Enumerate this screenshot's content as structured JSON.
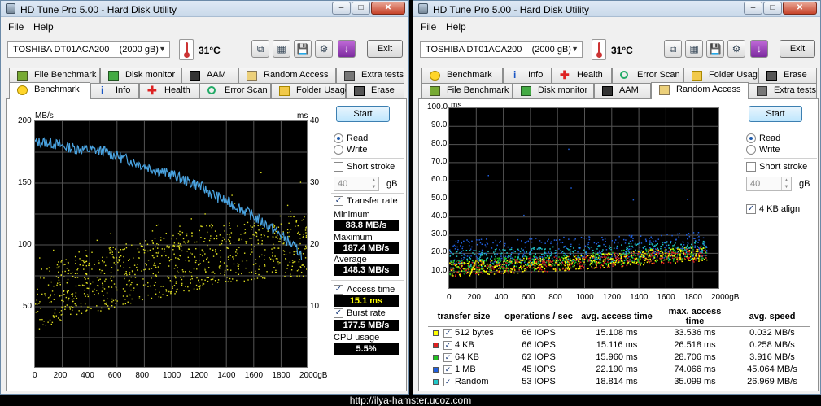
{
  "window_title": "HD Tune Pro 5.00 - Hard Disk Utility",
  "menu": {
    "file": "File",
    "help": "Help"
  },
  "drive": "TOSHIBA DT01ACA200",
  "drive_size": "(2000 gB)",
  "temperature": "31°C",
  "exit_label": "Exit",
  "start_label": "Start",
  "watermark": "http://ilya-hamster.ucoz.com",
  "left": {
    "tabs_row1": [
      "File Benchmark",
      "Disk monitor",
      "AAM",
      "Random Access",
      "Extra tests"
    ],
    "tabs_row2": [
      "Benchmark",
      "Info",
      "Health",
      "Error Scan",
      "Folder Usage",
      "Erase"
    ],
    "active_tab": "Benchmark",
    "chart": {
      "y_left_unit": "MB/s",
      "y_right_unit": "ms",
      "y_left_ticks": [
        "200",
        "150",
        "100",
        "50"
      ],
      "y_right_ticks": [
        "40",
        "30",
        "20",
        "10"
      ],
      "x_ticks": [
        "0",
        "200",
        "400",
        "600",
        "800",
        "1000",
        "1200",
        "1400",
        "1600",
        "1800",
        "2000gB"
      ]
    },
    "read_label": "Read",
    "write_label": "Write",
    "short_stroke_label": "Short stroke",
    "short_stroke_value": "40",
    "gb_label": "gB",
    "transfer_rate_label": "Transfer rate",
    "minimum_label": "Minimum",
    "minimum_value": "88.8 MB/s",
    "maximum_label": "Maximum",
    "maximum_value": "187.4 MB/s",
    "average_label": "Average",
    "average_value": "148.3 MB/s",
    "access_time_label": "Access time",
    "access_time_value": "15.1 ms",
    "burst_rate_label": "Burst rate",
    "burst_rate_value": "177.5 MB/s",
    "cpu_usage_label": "CPU usage",
    "cpu_usage_value": "5.5%"
  },
  "right": {
    "tabs_row1": [
      "Benchmark",
      "Info",
      "Health",
      "Error Scan",
      "Folder Usage",
      "Erase"
    ],
    "tabs_row2": [
      "File Benchmark",
      "Disk monitor",
      "AAM",
      "Random Access",
      "Extra tests"
    ],
    "active_tab": "Random Access",
    "chart": {
      "y_unit": "ms",
      "y_ticks": [
        "100.0",
        "90.0",
        "80.0",
        "70.0",
        "60.0",
        "50.0",
        "40.0",
        "30.0",
        "20.0",
        "10.0"
      ],
      "x_ticks": [
        "0",
        "200",
        "400",
        "600",
        "800",
        "1000",
        "1200",
        "1400",
        "1600",
        "1800",
        "2000gB"
      ]
    },
    "read_label": "Read",
    "write_label": "Write",
    "short_stroke_label": "Short stroke",
    "short_stroke_value": "40",
    "gb_label": "gB",
    "kb_align_label": "4 KB align",
    "table": {
      "headers": [
        "transfer size",
        "operations / sec",
        "avg. access time",
        "max. access time",
        "avg. speed"
      ],
      "rows": [
        {
          "name": "512 bytes",
          "color": "#ffff00",
          "ops": "66 IOPS",
          "avg": "15.108 ms",
          "max": "33.536 ms",
          "speed": "0.032 MB/s"
        },
        {
          "name": "4 KB",
          "color": "#e02020",
          "ops": "66 IOPS",
          "avg": "15.116 ms",
          "max": "26.518 ms",
          "speed": "0.258 MB/s"
        },
        {
          "name": "64 KB",
          "color": "#20c020",
          "ops": "62 IOPS",
          "avg": "15.960 ms",
          "max": "28.706 ms",
          "speed": "3.916 MB/s"
        },
        {
          "name": "1 MB",
          "color": "#2060e0",
          "ops": "45 IOPS",
          "avg": "22.190 ms",
          "max": "74.066 ms",
          "speed": "45.064 MB/s"
        },
        {
          "name": "Random",
          "color": "#20c8c8",
          "ops": "53 IOPS",
          "avg": "18.814 ms",
          "max": "35.099 ms",
          "speed": "26.969 MB/s"
        }
      ]
    }
  },
  "chart_data": [
    {
      "type": "line",
      "xlabel": "gB",
      "ylabel": "MB/s",
      "y2label": "ms",
      "xlim": [
        0,
        2000
      ],
      "ylim": [
        0,
        200
      ],
      "y2lim": [
        0,
        40
      ],
      "grid": true,
      "series": [
        {
          "name": "Transfer rate",
          "color": "#4aa3e0",
          "x": [
            0,
            100,
            200,
            300,
            400,
            500,
            600,
            700,
            800,
            900,
            1000,
            1100,
            1200,
            1300,
            1400,
            1500,
            1600,
            1700,
            1800,
            1900,
            1950
          ],
          "y": [
            183,
            183,
            180,
            178,
            177,
            176,
            172,
            168,
            164,
            160,
            157,
            152,
            148,
            141,
            135,
            130,
            123,
            116,
            108,
            98,
            92
          ]
        },
        {
          "name": "Access time",
          "color": "#e0e020",
          "axis": "right",
          "x": [
            0,
            200,
            400,
            600,
            800,
            1000,
            1200,
            1400,
            1600,
            1800,
            2000
          ],
          "y": [
            11,
            13,
            14,
            15,
            16,
            17,
            18,
            19,
            19,
            20,
            20
          ]
        }
      ]
    },
    {
      "type": "scatter",
      "xlabel": "gB",
      "ylabel": "ms",
      "xlim": [
        0,
        2000
      ],
      "ylim": [
        0,
        100
      ],
      "grid": true,
      "series": [
        {
          "name": "512 bytes",
          "color": "#ffff00",
          "x": [
            0,
            500,
            1000,
            1500,
            2000
          ],
          "y": [
            11,
            13,
            15,
            18,
            20
          ]
        },
        {
          "name": "4 KB",
          "color": "#e02020",
          "x": [
            0,
            500,
            1000,
            1500,
            2000
          ],
          "y": [
            11,
            13,
            15,
            18,
            20
          ]
        },
        {
          "name": "64 KB",
          "color": "#20c020",
          "x": [
            0,
            500,
            1000,
            1500,
            2000
          ],
          "y": [
            12,
            14,
            16,
            19,
            21
          ]
        },
        {
          "name": "1 MB",
          "color": "#2060e0",
          "x": [
            0,
            500,
            1000,
            1500,
            2000
          ],
          "y": [
            20,
            21,
            22,
            23,
            25
          ]
        },
        {
          "name": "Random",
          "color": "#20c8c8",
          "x": [
            0,
            500,
            1000,
            1500,
            2000
          ],
          "y": [
            16,
            18,
            19,
            21,
            22
          ]
        }
      ]
    }
  ]
}
